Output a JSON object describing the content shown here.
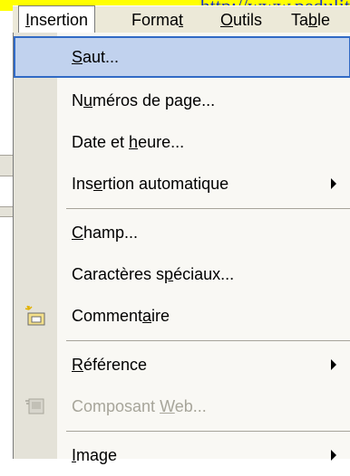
{
  "background": {
    "url_fragment": "http://www.pedulit"
  },
  "menubar": {
    "items": [
      {
        "pre": "",
        "key": "I",
        "post": "nsertion"
      },
      {
        "pre": "Forma",
        "key": "t",
        "post": ""
      },
      {
        "pre": "",
        "key": "O",
        "post": "utils"
      },
      {
        "pre": "Ta",
        "key": "b",
        "post": "le"
      }
    ]
  },
  "menu": {
    "items": [
      {
        "pre": "",
        "key": "S",
        "post": "aut..."
      },
      {
        "pre": "N",
        "key": "u",
        "post": "méros de page..."
      },
      {
        "pre": "Date et ",
        "key": "h",
        "post": "eure..."
      },
      {
        "pre": "Ins",
        "key": "e",
        "post": "rtion automatique"
      },
      {
        "pre": "",
        "key": "C",
        "post": "hamp..."
      },
      {
        "pre": "Caractères s",
        "key": "p",
        "post": "éciaux..."
      },
      {
        "pre": "Comment",
        "key": "a",
        "post": "ire"
      },
      {
        "pre": "",
        "key": "R",
        "post": "éférence"
      },
      {
        "pre": "Composant ",
        "key": "W",
        "post": "eb..."
      },
      {
        "pre": "",
        "key": "I",
        "post": "mage"
      }
    ]
  },
  "icons": [
    "comment-icon",
    "web-component-icon"
  ],
  "colors": {
    "highlight_bg": "#c1d2ee",
    "highlight_border": "#316ac5",
    "menubar_bg": "#ece9d8",
    "disabled_text": "#a7a59a"
  }
}
